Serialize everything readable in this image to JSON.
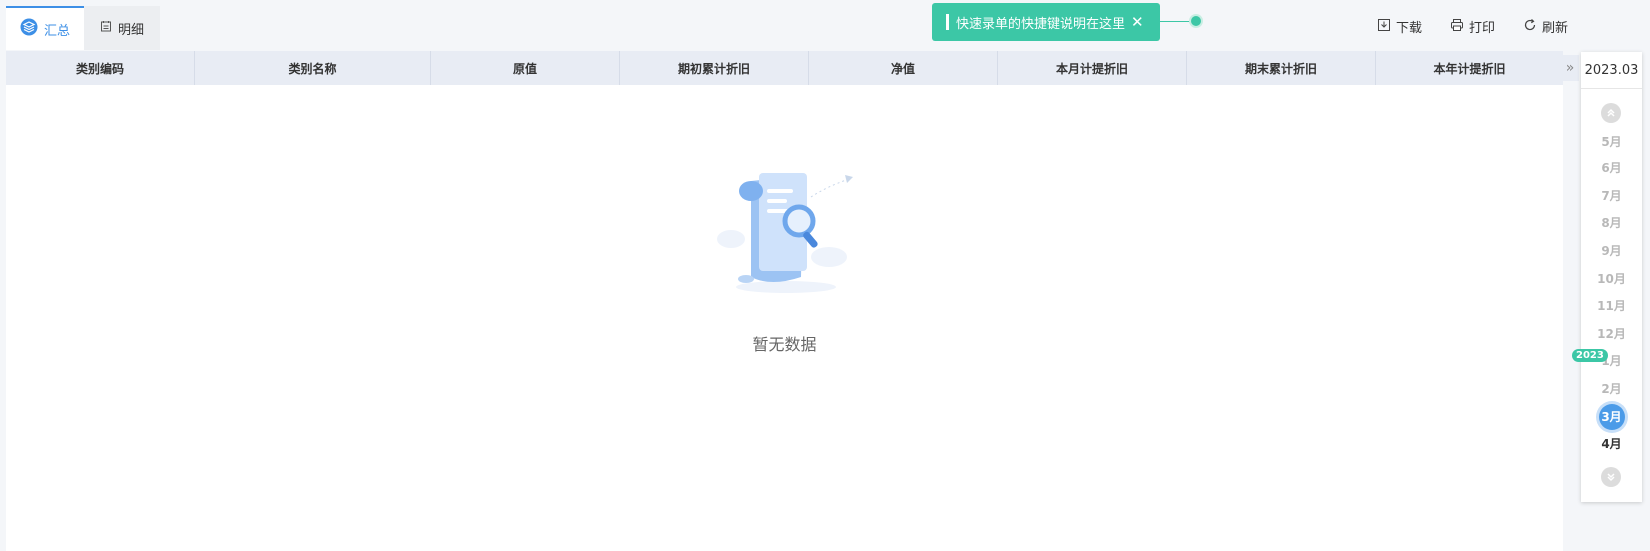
{
  "tabs": [
    {
      "label": "汇总",
      "icon": "layers-icon",
      "active": true
    },
    {
      "label": "明细",
      "icon": "calendar-doc-icon",
      "active": false
    }
  ],
  "hint": {
    "text": "快速录单的快捷键说明在这里",
    "close": "✕"
  },
  "toolbar": {
    "download": "下载",
    "print": "打印",
    "refresh": "刷新"
  },
  "table": {
    "columns": [
      "类别编码",
      "类别名称",
      "原值",
      "期初累计折旧",
      "净值",
      "本月计提折旧",
      "期末累计折旧",
      "本年计提折旧"
    ],
    "rows": [],
    "empty_text": "暂无数据"
  },
  "month_panel": {
    "current_period": "2023.03",
    "year_badge": "2023",
    "months": [
      "5月",
      "6月",
      "7月",
      "8月",
      "9月",
      "10月",
      "11月",
      "12月",
      "1月",
      "2月",
      "3月",
      "4月"
    ],
    "selected": "3月",
    "current": "4月"
  },
  "colors": {
    "accent": "#3d8fe6",
    "hint": "#3cc7a6",
    "selected_month": "#4b9be8",
    "header_bg": "#e8ecf4"
  }
}
